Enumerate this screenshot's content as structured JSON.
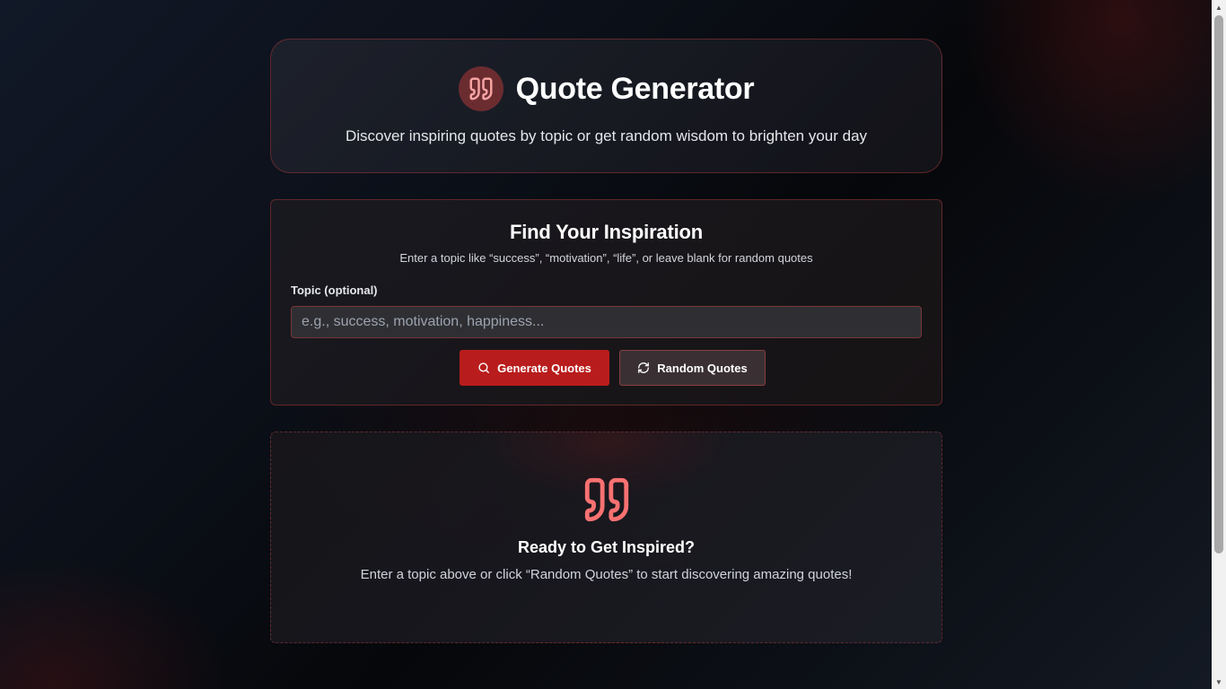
{
  "header": {
    "logo_icon": "quote-icon",
    "title": "Quote Generator",
    "subtitle": "Discover inspiring quotes by topic or get random wisdom to brighten your day"
  },
  "search": {
    "title": "Find Your Inspiration",
    "hint": "Enter a topic like “success”, “motivation”, “life”, or leave blank for random quotes",
    "topic_label": "Topic (optional)",
    "topic_value": "",
    "topic_placeholder": "e.g., success, motivation, happiness...",
    "generate_label": "Generate Quotes",
    "generate_icon": "search-icon",
    "random_label": "Random Quotes",
    "random_icon": "refresh-icon"
  },
  "empty_state": {
    "icon": "quote-icon",
    "title": "Ready to Get Inspired?",
    "text": "Enter a topic above or click “Random Quotes” to start discovering amazing quotes!"
  },
  "colors": {
    "accent": "#b91c1c",
    "quote_icon": "#f87171",
    "card_border": "#b93c3c"
  }
}
